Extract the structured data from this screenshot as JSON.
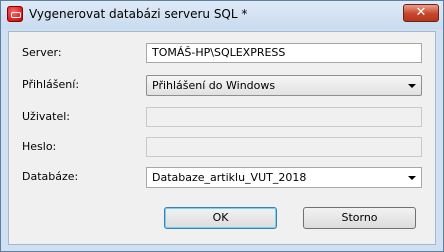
{
  "window": {
    "title": "Vygenerovat databázi serveru SQL *",
    "close_label": "✕",
    "icon": "database-app-icon"
  },
  "form": {
    "server": {
      "label": "Server:",
      "value": "TOMÁŠ-HP\\SQLEXPRESS"
    },
    "login": {
      "label": "Přihlášení:",
      "value": "Přihlášení do Windows"
    },
    "user": {
      "label": "Uživatel:",
      "value": ""
    },
    "password": {
      "label": "Heslo:",
      "value": ""
    },
    "database": {
      "label": "Databáze:",
      "value": "Databaze_artiklu_VUT_2018"
    }
  },
  "buttons": {
    "ok": "OK",
    "cancel": "Storno"
  },
  "colors": {
    "frame": "#cfe0f3",
    "client": "#f0f0f0",
    "close": "#c7452a",
    "default_button_focus": "#3c7fb1"
  }
}
